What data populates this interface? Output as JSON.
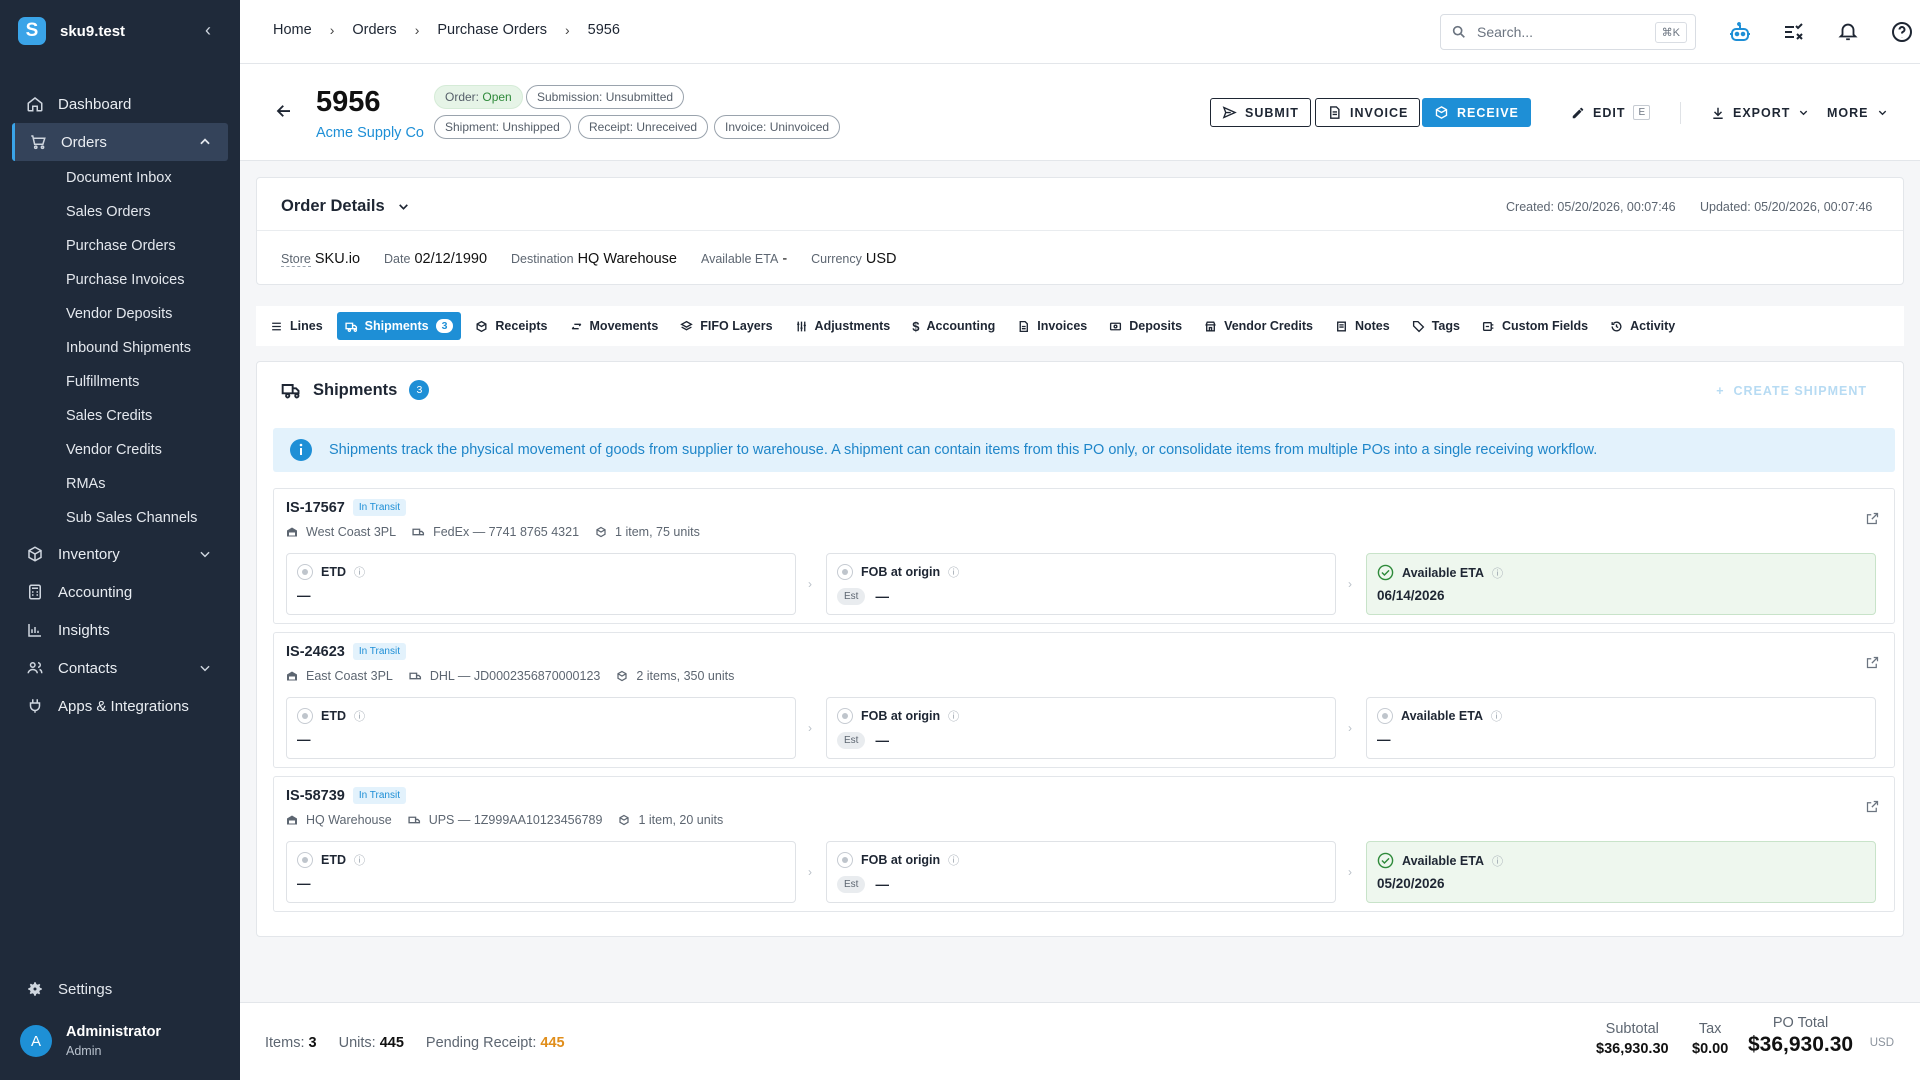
{
  "app": {
    "name": "sku9.test",
    "logo_letter": "S"
  },
  "sidebar": {
    "items": [
      {
        "label": "Dashboard",
        "icon": "home-icon"
      },
      {
        "label": "Orders",
        "icon": "cart-icon"
      },
      {
        "label": "Inventory",
        "icon": "box-icon"
      },
      {
        "label": "Accounting",
        "icon": "calculator-icon"
      },
      {
        "label": "Insights",
        "icon": "chart-icon"
      },
      {
        "label": "Contacts",
        "icon": "people-icon"
      },
      {
        "label": "Apps & Integrations",
        "icon": "plug-icon"
      }
    ],
    "orders_sub": [
      "Document Inbox",
      "Sales Orders",
      "Purchase Orders",
      "Purchase Invoices",
      "Vendor Deposits",
      "Inbound Shipments",
      "Fulfillments",
      "Sales Credits",
      "Vendor Credits",
      "RMAs",
      "Sub Sales Channels"
    ],
    "settings": "Settings",
    "user": {
      "initial": "A",
      "name": "Administrator",
      "role": "Admin"
    }
  },
  "breadcrumb": [
    "Home",
    "Orders",
    "Purchase Orders",
    "5956"
  ],
  "search": {
    "placeholder": "Search...",
    "shortcut": "⌘K"
  },
  "header": {
    "po_number": "5956",
    "vendor": "Acme Supply Co",
    "pills": {
      "order_label": "Order:",
      "order_value": "Open",
      "submission": "Submission: Unsubmitted",
      "shipment": "Shipment: Unshipped",
      "receipt": "Receipt: Unreceived",
      "invoice": "Invoice: Uninvoiced"
    },
    "buttons": {
      "submit": "SUBMIT",
      "invoice": "INVOICE",
      "receive": "RECEIVE",
      "edit": "EDIT",
      "edit_key": "E",
      "export": "EXPORT",
      "more": "MORE"
    }
  },
  "order_details": {
    "title": "Order Details",
    "created": "Created: 05/20/2026, 00:07:46",
    "updated": "Updated: 05/20/2026, 00:07:46",
    "fields": [
      {
        "label": "Store",
        "value": "SKU.io"
      },
      {
        "label": "Date",
        "value": "02/12/1990"
      },
      {
        "label": "Destination",
        "value": "HQ Warehouse"
      },
      {
        "label": "Available ETA",
        "value": "-"
      },
      {
        "label": "Currency",
        "value": "USD"
      }
    ]
  },
  "tabs": [
    {
      "label": "Lines",
      "icon": "list-icon"
    },
    {
      "label": "Shipments",
      "icon": "truck-icon",
      "count": "3"
    },
    {
      "label": "Receipts",
      "icon": "package-icon"
    },
    {
      "label": "Movements",
      "icon": "arrows-icon"
    },
    {
      "label": "FIFO Layers",
      "icon": "layers-icon"
    },
    {
      "label": "Adjustments",
      "icon": "sliders-icon"
    },
    {
      "label": "Accounting",
      "icon": "dollar-icon"
    },
    {
      "label": "Invoices",
      "icon": "document-icon"
    },
    {
      "label": "Deposits",
      "icon": "money-icon"
    },
    {
      "label": "Vendor Credits",
      "icon": "store-icon"
    },
    {
      "label": "Notes",
      "icon": "note-icon"
    },
    {
      "label": "Tags",
      "icon": "tag-icon"
    },
    {
      "label": "Custom Fields",
      "icon": "custom-icon"
    },
    {
      "label": "Activity",
      "icon": "history-icon"
    }
  ],
  "shipments": {
    "title": "Shipments",
    "count": "3",
    "create_label": "CREATE SHIPMENT",
    "info": "Shipments track the physical movement of goods from supplier to warehouse. A shipment can contain items from this PO only, or consolidate items from multiple POs into a single receiving workflow.",
    "etd_label": "ETD",
    "fob_label": "FOB at origin",
    "eta_label": "Available ETA",
    "est_label": "Est",
    "list": [
      {
        "id": "IS-17567",
        "status": "In Transit",
        "warehouse": "West Coast 3PL",
        "carrier": "FedEx — 7741 8765 4321",
        "items": "1 item, 75 units",
        "etd": "—",
        "fob": "—",
        "eta": "06/14/2026"
      },
      {
        "id": "IS-24623",
        "status": "In Transit",
        "warehouse": "East Coast 3PL",
        "carrier": "DHL — JD0002356870000123",
        "items": "2 items, 350 units",
        "etd": "—",
        "fob": "—",
        "eta": "—"
      },
      {
        "id": "IS-58739",
        "status": "In Transit",
        "warehouse": "HQ Warehouse",
        "carrier": "UPS — 1Z999AA10123456789",
        "items": "1 item, 20 units",
        "etd": "—",
        "fob": "—",
        "eta": "05/20/2026"
      }
    ]
  },
  "footer": {
    "items_label": "Items:",
    "items": "3",
    "units_label": "Units:",
    "units": "445",
    "pending_label": "Pending Receipt:",
    "pending": "445",
    "subtotal_label": "Subtotal",
    "subtotal": "$36,930.30",
    "tax_label": "Tax",
    "tax": "$0.00",
    "total_label": "PO Total",
    "total": "$36,930.30",
    "currency": "USD"
  },
  "colors": {
    "sidebar": "#1f2a3a",
    "accent": "#1e8fd6",
    "success": "#2e8a3a",
    "warning": "#e08e1b"
  }
}
